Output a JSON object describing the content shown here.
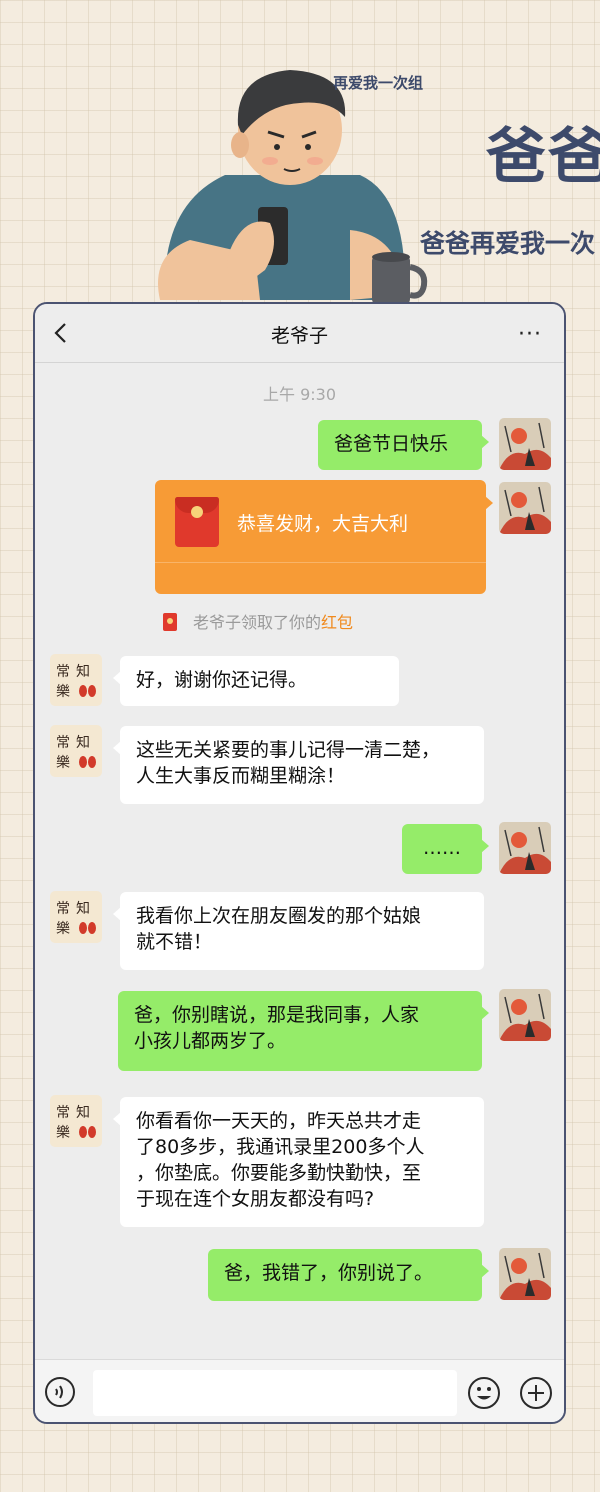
{
  "header": {
    "group_name": "再爱我一次组",
    "big_title": "爸爸",
    "subtitle": "爸爸再爱我一次"
  },
  "chat": {
    "contact_name": "老爷子",
    "more_label": "···",
    "time": "上午 9:30",
    "red_packet": {
      "text": "恭喜发财，大吉大利",
      "notice_prefix": "老爷子领取了你的",
      "notice_highlight": "红包"
    },
    "messages": [
      {
        "from": "me",
        "text": "爸爸节日快乐"
      },
      {
        "from": "dad",
        "text": "好，谢谢你还记得。"
      },
      {
        "from": "dad",
        "line1": "这些无关紧要的事儿记得一清二楚，",
        "line2": "人生大事反而糊里糊涂！"
      },
      {
        "from": "me",
        "text": "……"
      },
      {
        "from": "dad",
        "line1": "我看你上次在朋友圈发的那个姑娘",
        "line2": "就不错！"
      },
      {
        "from": "me",
        "line1": "爸，你别瞎说，那是我同事，人家",
        "line2": "小孩儿都两岁了。"
      },
      {
        "from": "dad",
        "line1": "你看看你一天天的，昨天总共才走",
        "line2": "了80多步，我通讯录里200多个人",
        "line3": "，你垫底。你要能多勤快勤快，至",
        "line4": "于现在连个女朋友都没有吗?"
      },
      {
        "from": "me",
        "text": "爸，我错了，你别说了。"
      }
    ],
    "dad_avatar_text": [
      "常",
      "知",
      "樂"
    ]
  },
  "colors": {
    "my_bubble": "#95ec69",
    "their_bubble": "#ffffff",
    "red_packet": "#f79b36",
    "title_color": "#3d4a6b"
  },
  "icons": {
    "back": "chevron-left-icon",
    "more": "more-dots-icon",
    "voice": "voice-icon",
    "emoji": "emoji-icon",
    "plus": "plus-icon"
  }
}
